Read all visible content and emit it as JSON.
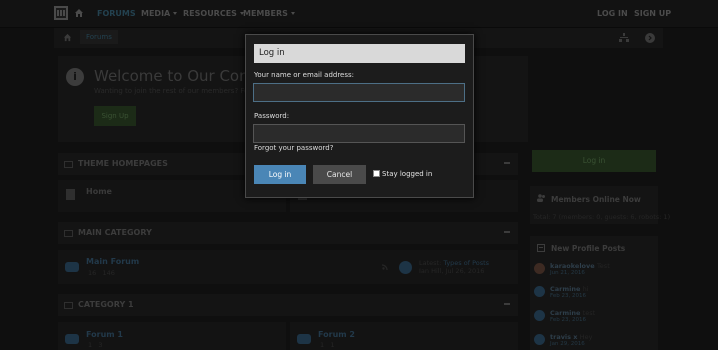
{
  "nav": {
    "items": [
      "FORUMS",
      "MEDIA",
      "RESOURCES",
      "MEMBERS"
    ],
    "login": "LOG IN",
    "signup": "SIGN UP"
  },
  "breadcrumb": {
    "forums": "Forums"
  },
  "welcome": {
    "title": "Welcome to Our Commun",
    "text": "Wanting to join the rest of our members? Feel f",
    "signup": "Sign Up"
  },
  "blocks": {
    "theme_homepages": "THEME HOMEPAGES",
    "home": "Home",
    "main_category": "MAIN CATEGORY",
    "main_forum": "Main Forum",
    "main_forum_stats": [
      "16",
      "146"
    ],
    "latest_label": "Latest:",
    "latest_title": "Types of Posts",
    "latest_meta": "Ian Hill, Jul 26, 2016",
    "category1": "CATEGORY 1",
    "forum1": "Forum 1",
    "forum1_stats": [
      "1",
      "3"
    ],
    "forum2": "Forum 2",
    "forum2_stats": [
      "1",
      "1"
    ]
  },
  "sidebar": {
    "login": "Log in",
    "members_online": "Members Online Now",
    "total": "Total: 7 (members: 0, guests: 6, robots: 1)",
    "new_profile_posts": "New Profile Posts",
    "posts": [
      {
        "name": "karaokelove",
        "text": "Test",
        "date": "Jun 21, 2016"
      },
      {
        "name": "Carmine",
        "text": "hi",
        "date": "Feb 23, 2016"
      },
      {
        "name": "Carmine",
        "text": "test",
        "date": "Feb 23, 2016"
      },
      {
        "name": "travis x",
        "text": "Hey",
        "date": "Jan 29, 2016"
      }
    ]
  },
  "modal": {
    "title": "Log in",
    "name_label": "Your name or email address:",
    "name_value": "",
    "password_label": "Password:",
    "password_value": "",
    "forgot": "Forgot your password?",
    "login_button": "Log in",
    "cancel_button": "Cancel",
    "stay_logged_in": "Stay logged in"
  }
}
